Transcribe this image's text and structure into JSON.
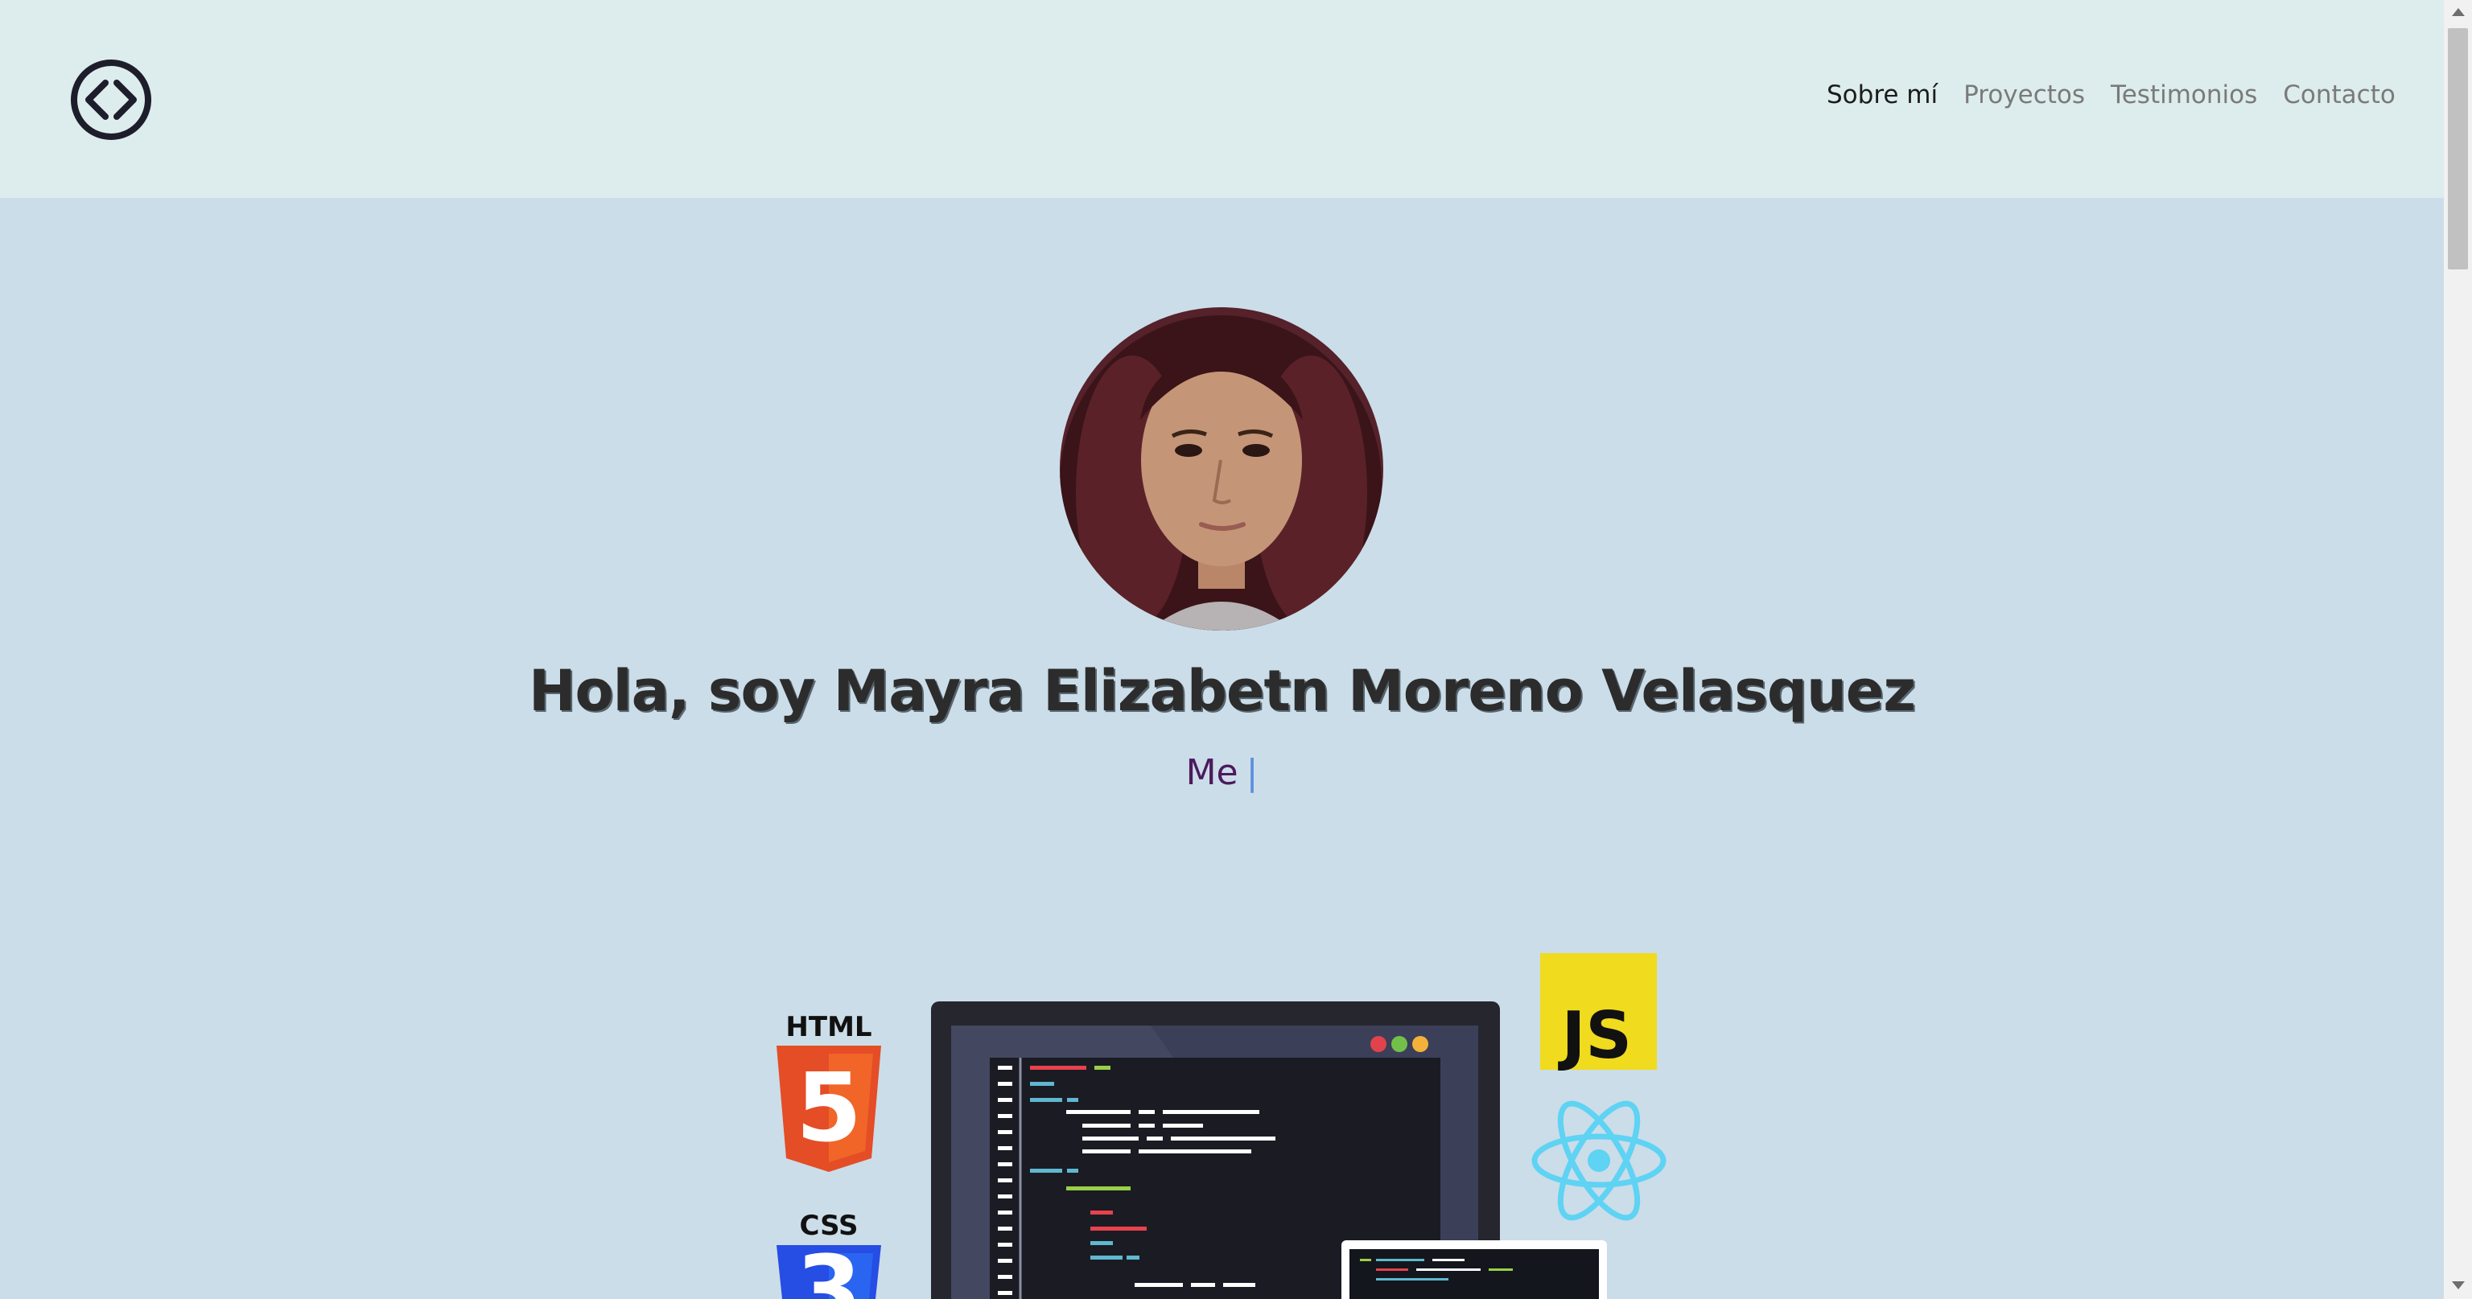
{
  "nav": {
    "logo_icon": "code-brackets-icon",
    "links": [
      {
        "label": "Sobre mí",
        "active": true
      },
      {
        "label": "Proyectos",
        "active": false
      },
      {
        "label": "Testimonios",
        "active": false
      },
      {
        "label": "Contacto",
        "active": false
      }
    ]
  },
  "hero": {
    "title": "Hola, soy Mayra Elizabetn Moreno Velasquez",
    "typed_text": "Me",
    "cursor": "|"
  },
  "illustration": {
    "html_label": "HTML",
    "html_digit": "5",
    "css_label": "CSS",
    "css_digit": "3",
    "js_label": "JS"
  },
  "colors": {
    "navbar_bg": "#ddecec",
    "page_bg": "#cbdde8",
    "typed_text": "#4c1a5c",
    "js_yellow": "#f0db1e",
    "react_blue": "#5ed3f3",
    "html_orange": "#e44d26",
    "css_blue": "#264de4"
  }
}
